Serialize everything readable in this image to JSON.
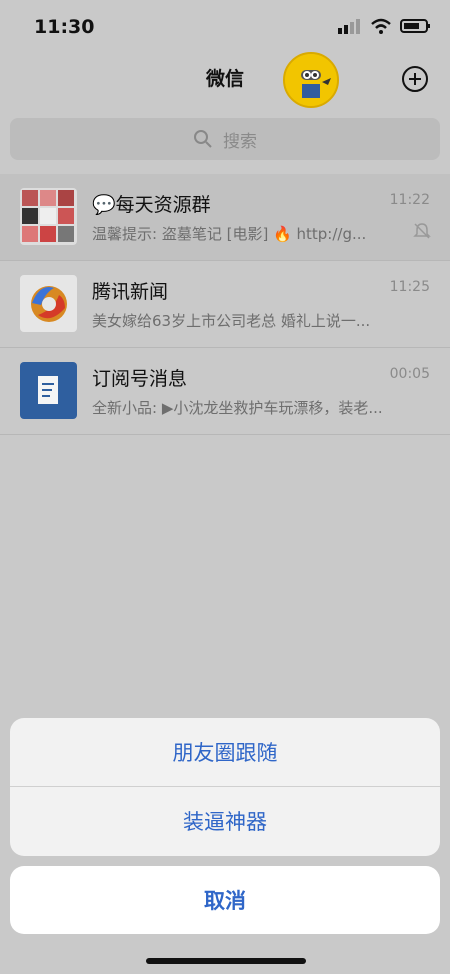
{
  "status": {
    "time": "11:30"
  },
  "header": {
    "title": "微信"
  },
  "search": {
    "placeholder": "搜索"
  },
  "chats": [
    {
      "name": "💬每天资源群",
      "preview": "温馨提示: 盗墓笔记 [电影] 🔥 http://g...",
      "time": "11:22"
    },
    {
      "name": "腾讯新闻",
      "preview": "美女嫁给63岁上市公司老总 婚礼上说一...",
      "time": "11:25"
    },
    {
      "name": "订阅号消息",
      "preview": "全新小品: ▶小沈龙坐救护车玩漂移，装老...",
      "time": "00:05"
    }
  ],
  "actionSheet": {
    "items": [
      "朋友圈跟随",
      "装逼神器"
    ],
    "cancel": "取消"
  }
}
